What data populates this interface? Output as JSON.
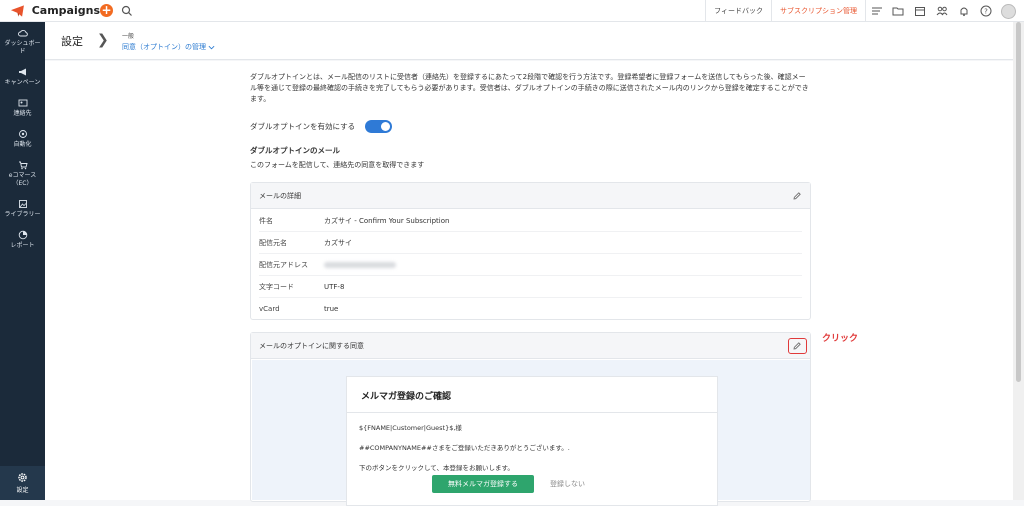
{
  "app": {
    "name": "Campaigns",
    "add_label": "+"
  },
  "topbar": {
    "links": [
      "フィードバック",
      "サブスクリプション管理"
    ],
    "icons": [
      "list-filter-icon",
      "folder-icon",
      "calendar-icon",
      "people-icon",
      "bell-icon",
      "help-icon"
    ]
  },
  "sidebar": {
    "items": [
      {
        "label": "ダッシュボード",
        "icon": "cloud-icon"
      },
      {
        "label": "キャンペーン",
        "icon": "megaphone-icon"
      },
      {
        "label": "連絡先",
        "icon": "contact-card-icon"
      },
      {
        "label": "自動化",
        "icon": "automation-icon"
      },
      {
        "label": "eコマース（EC）",
        "icon": "cart-icon"
      },
      {
        "label": "ライブラリー",
        "icon": "library-icon"
      },
      {
        "label": "レポート",
        "icon": "report-icon"
      }
    ],
    "settings_label": "設定"
  },
  "header": {
    "title": "設定",
    "crumb_small": "一般",
    "crumb_link": "同意（オプトイン）の管理"
  },
  "intro": "ダブルオプトインとは、メール配信のリストに受信者（連絡先）を登録するにあたって2段階で確認を行う方法です。登録希望者に登録フォームを送信してもらった後、確認メール等を通じて登録の最終確認の手続きを完了してもらう必要があります。受信者は、ダブルオプトインの手続きの際に送信されたメール内のリンクから登録を確定することができます。",
  "toggle": {
    "label": "ダブルオプトインを有効にする",
    "enabled": true
  },
  "section": {
    "title": "ダブルオプトインのメール",
    "subtitle": "このフォームを配信して、連絡先の同意を取得できます"
  },
  "mail_details": {
    "title": "メールの詳細",
    "rows": [
      {
        "label": "件名",
        "value": "カズサイ - Confirm Your Subscription"
      },
      {
        "label": "配信元名",
        "value": "カズサイ"
      },
      {
        "label": "配信元アドレス",
        "value": ""
      },
      {
        "label": "文字コード",
        "value": "UTF-8"
      },
      {
        "label": "vCard",
        "value": "true"
      }
    ]
  },
  "consent": {
    "title": "メールのオプトインに関する同意",
    "annotation": "クリック",
    "annotation_color": "#e03a3a"
  },
  "mail_preview": {
    "title": "メルマガ登録のご確認",
    "line1": "${FNAME|Customer|Guest}$,様",
    "line2": "##COMPANYNAME##さまをご登録いただきありがとうございます。.",
    "line3": "下のボタンをクリックして、本登録をお願いします。",
    "button": "無料メルマガ登録する",
    "decline": "登録しない"
  },
  "colors": {
    "accent": "#2f7ad6",
    "brand_orange": "#f26b21",
    "sidebar": "#1b2a3a",
    "button_green": "#2ea56d"
  }
}
